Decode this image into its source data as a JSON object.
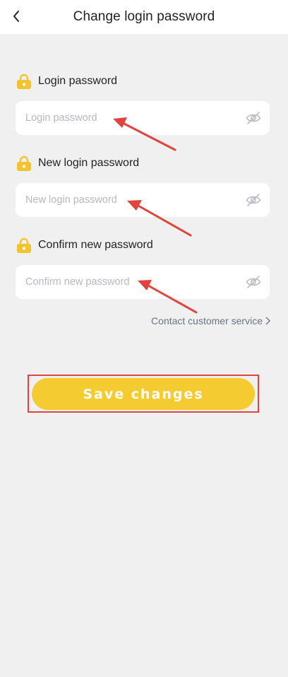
{
  "header": {
    "title": "Change login password"
  },
  "form": {
    "login_password": {
      "label": "Login password",
      "placeholder": "Login password",
      "value": ""
    },
    "new_password": {
      "label": "New login password",
      "placeholder": "New login password",
      "value": ""
    },
    "confirm_password": {
      "label": "Confirm new password",
      "placeholder": "Confirm new password",
      "value": ""
    }
  },
  "contact_link": "Contact customer service",
  "save_button": "Save changes",
  "colors": {
    "accent": "#f4cc32",
    "annotation": "#e0443e",
    "background": "#f0f0f0"
  }
}
